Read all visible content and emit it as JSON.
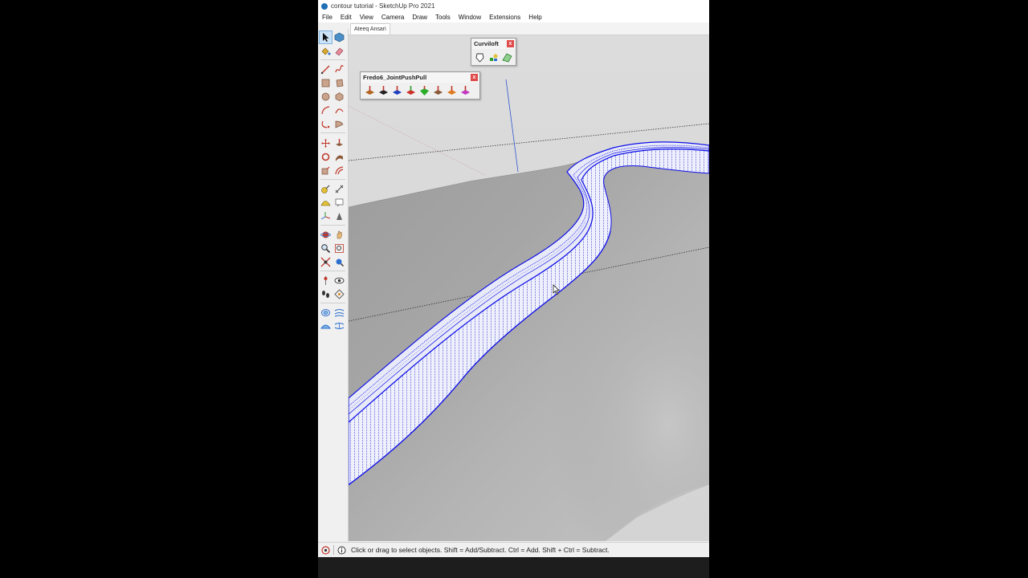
{
  "window": {
    "title": "contour tutorial - SketchUp Pro 2021"
  },
  "menubar": {
    "items": [
      "File",
      "Edit",
      "View",
      "Camera",
      "Draw",
      "Tools",
      "Window",
      "Extensions",
      "Help"
    ]
  },
  "tabs": {
    "active_scene": "Ateeq Ansari"
  },
  "toolbar_curviloft": {
    "title": "Curviloft",
    "close": "x",
    "icons": [
      "curviloft-loft-by-spline-icon",
      "curviloft-skinning-icon",
      "curviloft-loft-along-path-icon"
    ]
  },
  "toolbar_jointpushpull": {
    "title": "Fredo6_JointPushPull",
    "close": "x",
    "icons": [
      "joint-push-pull-icon",
      "vector-push-pull-icon",
      "normal-push-pull-icon",
      "extrude-icon",
      "follow-icon",
      "undo-push-pull-icon",
      "redo-push-pull-icon",
      "joint-options-icon"
    ]
  },
  "statusbar": {
    "message": "Click or drag to select objects. Shift = Add/Subtract. Ctrl = Add. Shift + Ctrl = Subtract."
  },
  "colors": {
    "selection_blue": "#1010e8",
    "terrain_gray": "#a9a9a9",
    "background": "#dcdcdc",
    "close_red": "#e04a4a"
  }
}
